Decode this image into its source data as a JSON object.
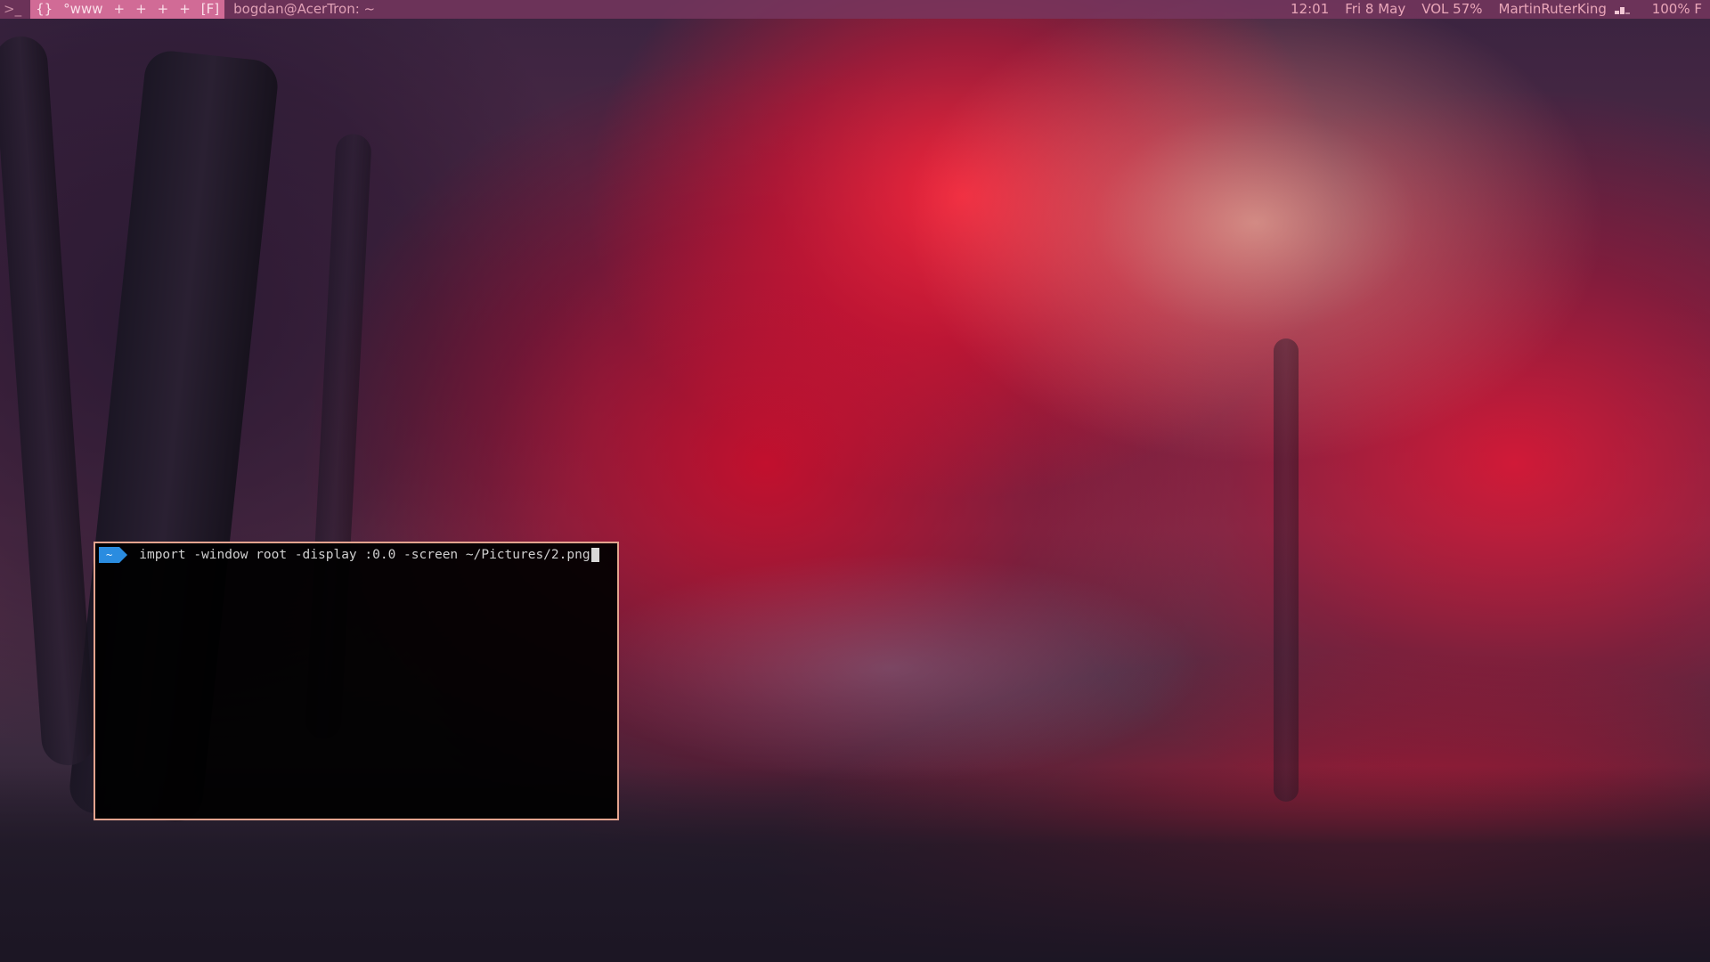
{
  "topbar": {
    "terminal_glyph": ">_",
    "workspaces": [
      "{}",
      "°www",
      "+",
      "+",
      "+",
      "+"
    ],
    "layout": "[F]",
    "window_title": "bogdan@AcerTron: ~",
    "clock": "12:01",
    "date": "Fri 8 May",
    "volume": "VOL 57%",
    "network": "MartinRuterKing",
    "battery": "100% F"
  },
  "terminal": {
    "prompt_dir": "~",
    "command": "import -window root -display :0.0 -screen ~/Pictures/2.png"
  },
  "colors": {
    "topbar_bg": "#7a3760",
    "topbar_active": "#d16b96",
    "terminal_border": "#e3a38e",
    "prompt_badge": "#2a8ce0"
  }
}
